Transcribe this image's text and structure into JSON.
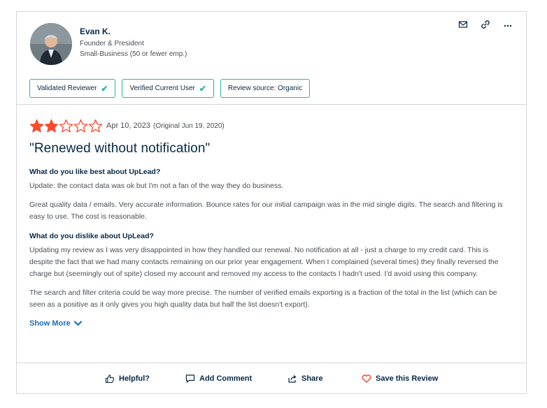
{
  "reviewer": {
    "name": "Evan K.",
    "title": "Founder & President",
    "company_size": "Small-Business (50 or fewer emp.)",
    "avatar_icon": "user-photo"
  },
  "header_actions": [
    {
      "icon": "mail-icon",
      "glyph": "envelope"
    },
    {
      "icon": "link-icon",
      "glyph": "chain-link"
    },
    {
      "icon": "more-icon",
      "glyph": "..."
    }
  ],
  "badges": [
    {
      "label": "Validated Reviewer",
      "check": "✔"
    },
    {
      "label": "Verified Current User",
      "check": "✔"
    },
    {
      "label": "Review source: Organic",
      "check": ""
    }
  ],
  "review": {
    "rating": 2,
    "max_rating": 5,
    "date": "Apr 10, 2023",
    "original_date": "(Original Jun 19, 2020)",
    "title": "\"Renewed without notification\"",
    "q_like": "What do you like best about UpLead?",
    "like_1": "Update: the contact data was ok but I'm not a fan of the way they do business.",
    "like_2": "Great quality data / emails. Very accurate information. Bounce rates for our initial campaign was in the mid single digits. The search and filtering is easy to use. The cost is reasonable.",
    "q_dislike": "What do you dislike about UpLead?",
    "dislike_1": "Updating my review as I was very disappointed in how they handled our renewal. No notification at all - just a charge to my credit card. This is despite the fact that we had many contacts remaining on our prior year engagement. When I complained (several times) they finally reversed the charge but (seemingly out of spite) closed my account and removed my access to the contacts I hadn't used. I'd avoid using this company.",
    "dislike_2": "The search and filter criteria could be way more precise. The number of verified emails exporting is a fraction of the total in the list (which can be seen as a positive as it only gives you high quality data but half the list doesn't export).",
    "show_more": "Show More"
  },
  "footer": {
    "helpful": "Helpful?",
    "comment": "Add Comment",
    "share": "Share",
    "save": "Save this Review"
  },
  "colors": {
    "star": "#ff492c",
    "badge_border": "#27b69f",
    "link": "#1d6fb8",
    "heart": "#ff492c"
  }
}
